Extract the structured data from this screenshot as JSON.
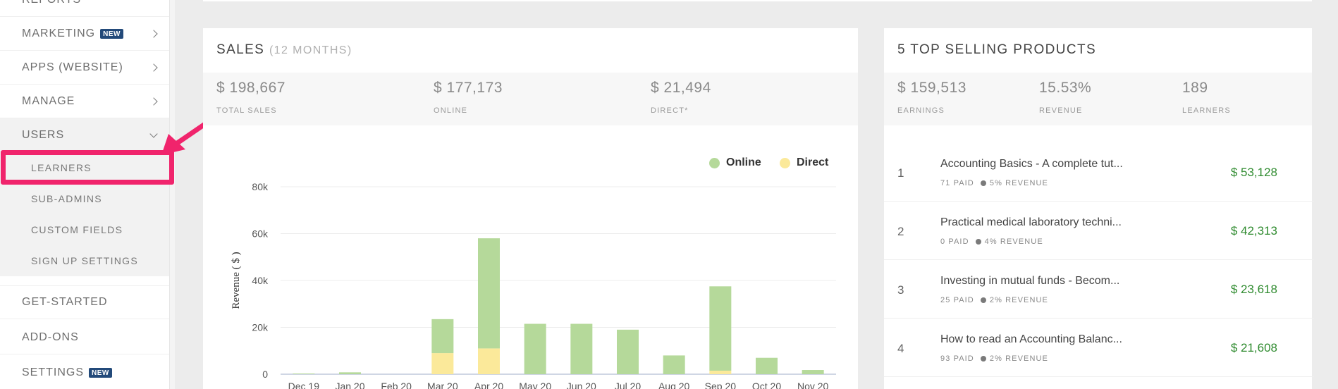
{
  "sidebar": {
    "reports_label": "REPORTS",
    "items": [
      {
        "label": "MARKETING",
        "badge": "NEW",
        "chevron": "right"
      },
      {
        "label": "APPS (WEBSITE)",
        "chevron": "right"
      },
      {
        "label": "MANAGE",
        "chevron": "right"
      },
      {
        "label": "USERS",
        "chevron": "down"
      }
    ],
    "subitems": [
      "LEARNERS",
      "SUB-ADMINS",
      "CUSTOM FIELDS",
      "SIGN UP SETTINGS"
    ],
    "bottom_items": [
      {
        "label": "GET-STARTED"
      },
      {
        "label": "ADD-ONS"
      },
      {
        "label": "SETTINGS",
        "badge": "NEW"
      }
    ],
    "highlight_color": "#f0246c",
    "badge_color": "#234a7a"
  },
  "sales": {
    "title": "SALES",
    "subtitle": "(12 MONTHS)",
    "stats": [
      {
        "value": "$ 198,667",
        "label": "TOTAL SALES"
      },
      {
        "value": "$ 177,173",
        "label": "ONLINE"
      },
      {
        "value": "$ 21,494",
        "label": "DIRECT*"
      }
    ]
  },
  "products": {
    "title": "5 TOP SELLING PRODUCTS",
    "stats": [
      {
        "value": "$ 159,513",
        "label": "EARNINGS"
      },
      {
        "value": "15.53%",
        "label": "REVENUE"
      },
      {
        "value": "189",
        "label": "LEARNERS"
      }
    ],
    "rows": [
      {
        "rank": "1",
        "name": "Accounting Basics - A complete tut...",
        "paid": "71 PAID",
        "revenue": "5% REVENUE",
        "amount": "$ 53,128"
      },
      {
        "rank": "2",
        "name": "Practical medical laboratory techni...",
        "paid": "0 PAID",
        "revenue": "4% REVENUE",
        "amount": "$ 42,313"
      },
      {
        "rank": "3",
        "name": "Investing in mutual funds - Becom...",
        "paid": "25 PAID",
        "revenue": "2% REVENUE",
        "amount": "$ 23,618"
      },
      {
        "rank": "4",
        "name": "How to read an Accounting Balanc...",
        "paid": "93 PAID",
        "revenue": "2% REVENUE",
        "amount": "$ 21,608"
      }
    ],
    "amount_color": "#2f8b2f"
  },
  "chart_data": {
    "type": "bar",
    "stacked": true,
    "ylabel": "Revenue ( $ )",
    "ylim": [
      0,
      80000
    ],
    "yticks": [
      0,
      20000,
      40000,
      60000,
      80000
    ],
    "ytick_labels": [
      "0",
      "20k",
      "40k",
      "60k",
      "80k"
    ],
    "categories": [
      "Dec 19",
      "Jan 20",
      "Feb 20",
      "Mar 20",
      "Apr 20",
      "May 20",
      "Jun 20",
      "Jul 20",
      "Aug 20",
      "Sep 20",
      "Oct 20",
      "Nov 20"
    ],
    "series": [
      {
        "name": "Direct",
        "color": "#fbe99a",
        "values": [
          0,
          0,
          0,
          9000,
          11000,
          0,
          0,
          0,
          0,
          1500,
          0,
          0
        ]
      },
      {
        "name": "Online",
        "color": "#b5d99a",
        "values": [
          300,
          800,
          0,
          14500,
          47000,
          21500,
          21500,
          19000,
          8000,
          36000,
          7000,
          1800
        ]
      }
    ],
    "legend_order": [
      "Online",
      "Direct"
    ],
    "legend_position": "top-right",
    "grid": true
  }
}
